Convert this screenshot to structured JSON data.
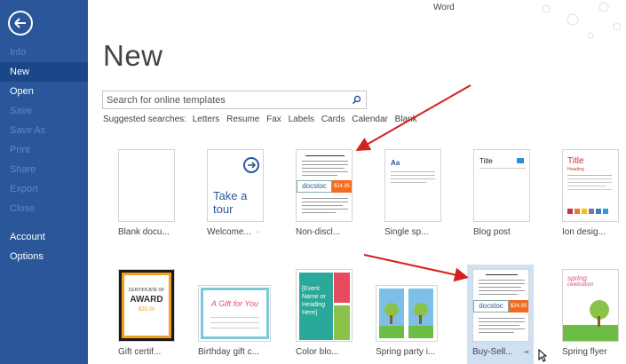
{
  "app": {
    "name": "Word"
  },
  "sidebar": {
    "back_label": "Back",
    "items": [
      {
        "label": "Info",
        "state": "disabled"
      },
      {
        "label": "New",
        "state": "active"
      },
      {
        "label": "Open",
        "state": "normal"
      },
      {
        "label": "Save",
        "state": "disabled"
      },
      {
        "label": "Save As",
        "state": "disabled"
      },
      {
        "label": "Print",
        "state": "disabled"
      },
      {
        "label": "Share",
        "state": "disabled"
      },
      {
        "label": "Export",
        "state": "disabled"
      },
      {
        "label": "Close",
        "state": "disabled"
      },
      {
        "label": "Account",
        "state": "normal"
      },
      {
        "label": "Options",
        "state": "normal"
      }
    ]
  },
  "main": {
    "title": "New",
    "search": {
      "placeholder": "Search for online templates",
      "value": ""
    },
    "suggested": {
      "label": "Suggested searches:",
      "links": [
        "Letters",
        "Resume",
        "Fax",
        "Labels",
        "Cards",
        "Calendar",
        "Blank"
      ]
    },
    "templates": [
      {
        "label": "Blank docu..."
      },
      {
        "label": "Welcome...",
        "text": "Take a tour"
      },
      {
        "label": "Non-discl...",
        "brand": "docstoc",
        "price": "$24.95"
      },
      {
        "label": "Single sp...",
        "text": "Aa"
      },
      {
        "label": "Blog post",
        "text": "Title"
      },
      {
        "label": "Ion desig...",
        "text": "Title",
        "subtext": "Heading"
      },
      {
        "label": "Gift certif...",
        "text": "CERTIFICATE OF",
        "text2": "AWARD",
        "text3": "$25.00"
      },
      {
        "label": "Birthday gift c...",
        "text": "A Gift for You"
      },
      {
        "label": "Color blo...",
        "text": "[Event Name or Heading Here]"
      },
      {
        "label": "Spring party i..."
      },
      {
        "label": "Buy-Sell...",
        "brand": "docstoc",
        "price": "$24.95"
      },
      {
        "label": "Spring flyer",
        "text": "spring",
        "text2": "celebration"
      }
    ]
  },
  "colors": {
    "sidebar_bg": "#2b579a",
    "sidebar_active": "#19478a",
    "accent": "#2b579a",
    "annotation_arrow": "#d32020",
    "price_tag": "#f26b21"
  }
}
